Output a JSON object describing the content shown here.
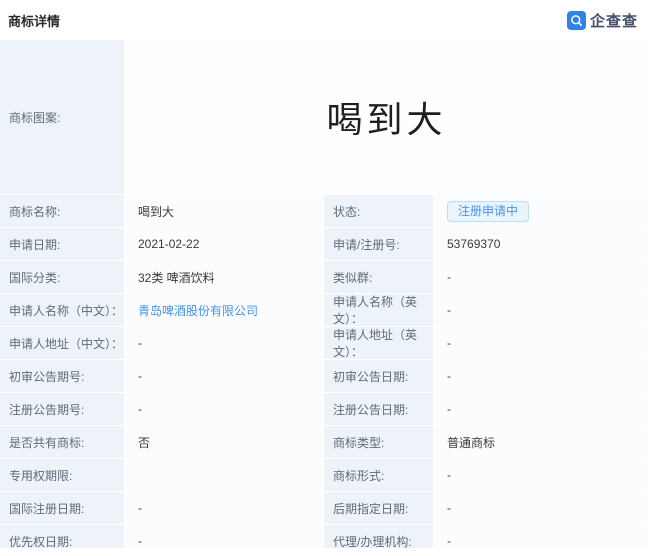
{
  "header": {
    "title": "商标详情",
    "brand": "企查查"
  },
  "colors": {
    "accent_blue": "#2f83e4",
    "link_blue": "#4795e4",
    "badge_bg": "#e9f4fd",
    "label_cell_bg": "#edf3f9",
    "value_cell_bg": "#fafcfe"
  },
  "trademark": {
    "image_label": "商标图案:",
    "image_text": "喝到大"
  },
  "rows": [
    {
      "left_label": "商标名称:",
      "left_value": "喝到大",
      "right_label": "状态:",
      "right_value": "注册申请中"
    },
    {
      "left_label": "申请日期:",
      "left_value": "2021-02-22",
      "right_label": "申请/注册号:",
      "right_value": "53769370"
    },
    {
      "left_label": "国际分类:",
      "left_value": "32类 啤酒饮料",
      "right_label": "类似群:",
      "right_value": "-"
    },
    {
      "left_label": "申请人名称（中文）：",
      "left_value": "青岛啤酒股份有限公司",
      "right_label": "申请人名称（英文）：",
      "right_value": "-"
    },
    {
      "left_label": "申请人地址（中文）：",
      "left_value": "-",
      "right_label": "申请人地址（英文）：",
      "right_value": "-"
    },
    {
      "left_label": "初审公告期号:",
      "left_value": "-",
      "right_label": "初审公告日期:",
      "right_value": "-"
    },
    {
      "left_label": "注册公告期号:",
      "left_value": "-",
      "right_label": "注册公告日期:",
      "right_value": "-"
    },
    {
      "left_label": "是否共有商标:",
      "left_value": "否",
      "right_label": "商标类型:",
      "right_value": "普通商标"
    },
    {
      "left_label": "专用权期限:",
      "left_value": "",
      "right_label": "商标形式:",
      "right_value": "-"
    },
    {
      "left_label": "国际注册日期:",
      "left_value": "-",
      "right_label": "后期指定日期:",
      "right_value": "-"
    },
    {
      "left_label": "优先权日期:",
      "left_value": "-",
      "right_label": "代理/办理机构:",
      "right_value": "-"
    }
  ]
}
